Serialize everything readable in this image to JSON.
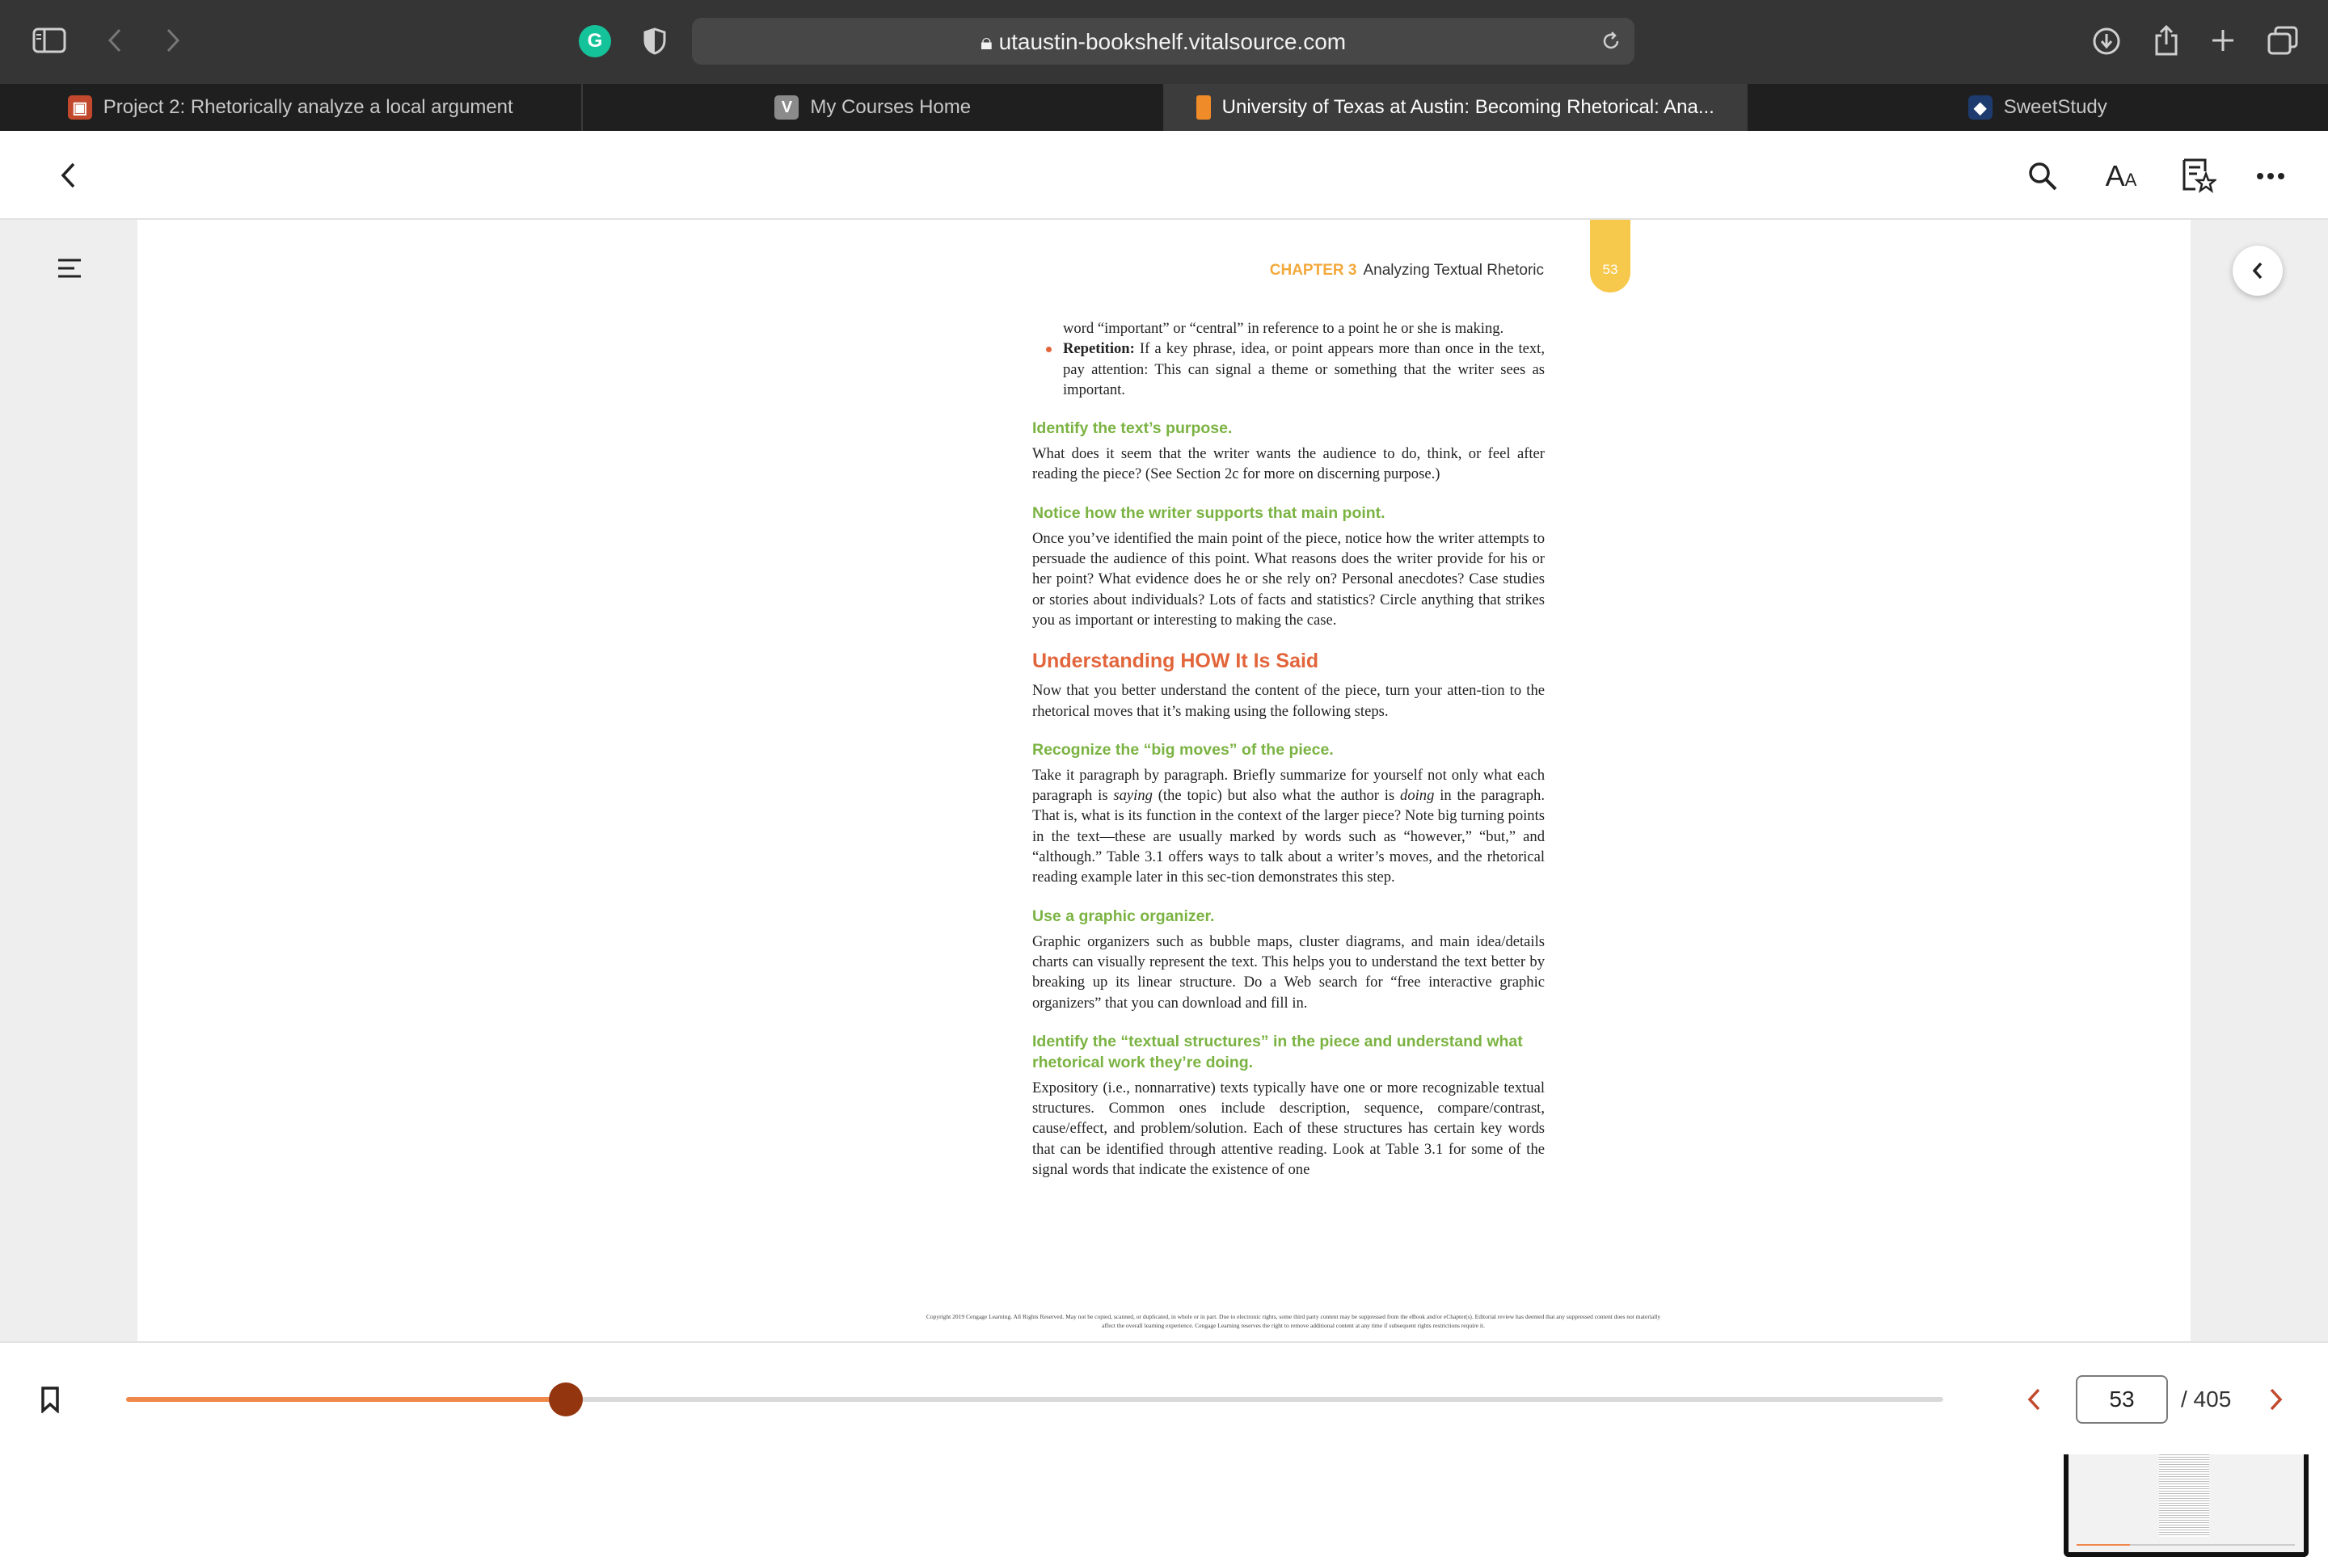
{
  "browser": {
    "url": "utaustin-bookshelf.vitalsource.com",
    "tabs": [
      {
        "title": "Project 2: Rhetorically analyze a local argument",
        "favicon": "canvas-icon",
        "active": false
      },
      {
        "title": "My Courses Home",
        "favicon": "V",
        "active": false
      },
      {
        "title": "University of Texas at Austin: Becoming Rhetorical: Ana...",
        "favicon": "vitalsource-icon",
        "active": true
      },
      {
        "title": "SweetStudy",
        "favicon": "sweetstudy-icon",
        "active": false
      }
    ]
  },
  "page": {
    "running_head": {
      "chapter": "CHAPTER 3",
      "title": "Analyzing Textual Rhetoric"
    },
    "page_number": "53",
    "top_continuation": "word “important” or “central” in reference to a point he or she is making.",
    "bullet": {
      "label": "Repetition:",
      "text": " If a key phrase, idea, or point appears more than once in the text, pay attention: This can signal a theme or something that the writer sees as important."
    },
    "s1_head": "Identify the text’s purpose.",
    "s1_body": "What does it seem that the writer wants the audience to do, think, or feel after reading the piece? (See Section 2c for more on discerning purpose.)",
    "s2_head": "Notice how the writer supports that main point.",
    "s2_body": "Once you’ve identified the main point of the piece, notice how the writer attempts to persuade the audience of this point. What reasons does the writer provide for his or her point? What evidence does he or she rely on? Personal anecdotes? Case studies or stories about individuals? Lots of facts and statistics? Circle anything that strikes you as important or interesting to making the case.",
    "h2": "Understanding HOW It Is Said",
    "h2_body": "Now that you better understand the content of the piece, turn your atten-tion to the rhetorical moves that it’s making using the following steps.",
    "s3_head": "Recognize the “big moves” of the piece.",
    "s3_body_a": "Take it paragraph by paragraph. Briefly summarize for yourself not only what each paragraph is ",
    "s3_body_saying": "saying",
    "s3_body_b": " (the topic) but also what the author is ",
    "s3_body_doing": "doing",
    "s3_body_c": " in the paragraph. That is, what is its function in the context of the larger piece? Note big turning points in the text—these are usually marked by words such as “however,” “but,” and “although.” Table 3.1 offers ways to talk about a writer’s moves, and the rhetorical reading example later in this sec-tion demonstrates this step.",
    "s4_head": "Use a graphic organizer.",
    "s4_body": "Graphic organizers such as bubble maps, cluster diagrams, and main idea/details charts can visually represent the text. This helps you to understand the text better by breaking up its linear structure. Do a Web search for “free interactive graphic organizers” that you can download and fill in.",
    "s5_head": "Identify the “textual structures” in the piece and understand what rhetorical work they’re doing.",
    "s5_body": "Expository (i.e., nonnarrative) texts typically have one or more recognizable textual structures. Common ones include description, sequence, compare/contrast, cause/effect, and problem/solution. Each of these structures has certain key words that can be identified through attentive reading. Look at Table 3.1 for some of the signal words that indicate the existence of one",
    "copyright": "Copyright 2019 Cengage Learning. All Rights Reserved. May not be copied, scanned, or duplicated, in whole or in part. Due to electronic rights, some third party content may be suppressed from the eBook and/or eChapter(s). Editorial review has deemed that any suppressed content does not materially affect the overall learning experience. Cengage Learning reserves the right to remove additional content at any time if subsequent rights restrictions require it."
  },
  "navigation": {
    "current_page": "53",
    "total_pages": "/ 405",
    "progress_fraction": 0.242
  },
  "colors": {
    "accent": "#e2653b",
    "heading": "#7bb343",
    "chapter": "#f3a93b",
    "progress": "#f0884b",
    "knob": "#93350e"
  }
}
